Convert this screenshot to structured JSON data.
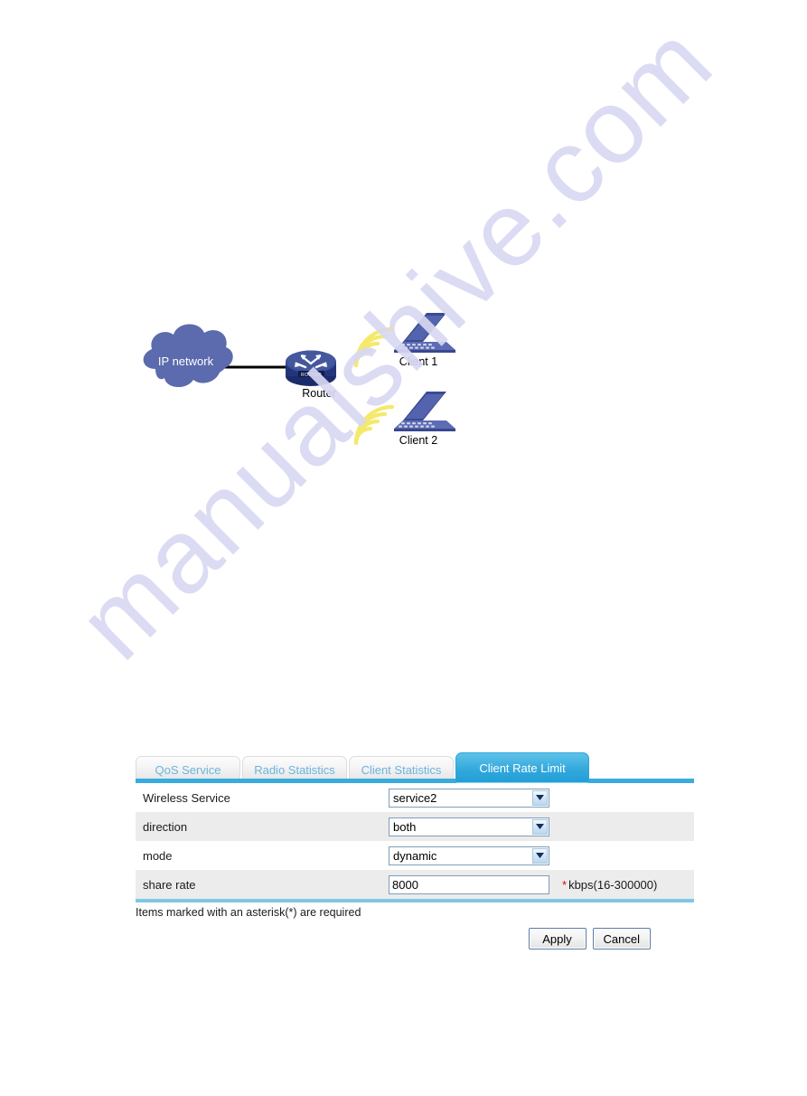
{
  "watermark": {
    "text": "manualshive.com"
  },
  "diagram": {
    "cloud_label": "IP network",
    "router_label": "Router",
    "router_badge": "ROUTER",
    "client1_label": "Client 1",
    "client2_label": "Client 2",
    "colors": {
      "cloud_fill": "#5b6bad",
      "device_fill": "#4a5699",
      "wifi": "#f5e96b",
      "link": "#000000"
    }
  },
  "ui": {
    "tabs": [
      {
        "label": "QoS Service",
        "active": false
      },
      {
        "label": "Radio Statistics",
        "active": false
      },
      {
        "label": "Client Statistics",
        "active": false
      },
      {
        "label": "Client Rate Limit",
        "active": true
      }
    ],
    "fields": [
      {
        "label": "Wireless Service",
        "type": "select",
        "value": "service2",
        "hint": ""
      },
      {
        "label": "direction",
        "type": "select",
        "value": "both",
        "hint": ""
      },
      {
        "label": "mode",
        "type": "select",
        "value": "dynamic",
        "hint": ""
      },
      {
        "label": "share rate",
        "type": "text",
        "value": "8000",
        "required_mark": "*",
        "hint": "kbps(16-300000)"
      }
    ],
    "required_note": "Items marked with an asterisk(*) are required",
    "buttons": {
      "apply": "Apply",
      "cancel": "Cancel"
    },
    "colors": {
      "accent": "#33a8dc",
      "tab_inactive_text": "#6ab4dd",
      "required": "#ee0000"
    }
  }
}
